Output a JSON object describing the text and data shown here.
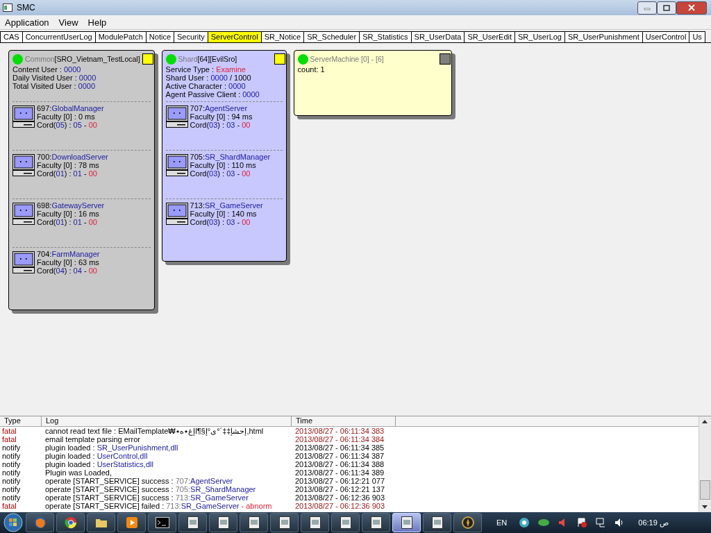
{
  "window": {
    "title": "SMC"
  },
  "menu": [
    "Application",
    "View",
    "Help"
  ],
  "tabs": [
    {
      "label": "CAS",
      "selected": false
    },
    {
      "label": "ConcurrentUserLog",
      "selected": false
    },
    {
      "label": "ModulePatch",
      "selected": false
    },
    {
      "label": "Notice",
      "selected": false
    },
    {
      "label": "Security",
      "selected": false
    },
    {
      "label": "ServerControl",
      "selected": true
    },
    {
      "label": "SR_Notice",
      "selected": false
    },
    {
      "label": "SR_Scheduler",
      "selected": false
    },
    {
      "label": "SR_Statistics",
      "selected": false
    },
    {
      "label": "SR_UserData",
      "selected": false
    },
    {
      "label": "SR_UserEdit",
      "selected": false
    },
    {
      "label": "SR_UserLog",
      "selected": false
    },
    {
      "label": "SR_UserPunishment",
      "selected": false
    },
    {
      "label": "UserControl",
      "selected": false
    },
    {
      "label": "Us",
      "selected": false
    }
  ],
  "cards": [
    {
      "kind": "common",
      "online": true,
      "color": "#ffff00",
      "group": "Common",
      "name": "[SRO_Vietnam_TestLocal]",
      "stats": [
        {
          "label": "Content User : ",
          "value": "0000"
        },
        {
          "label": "Daily Visited User : ",
          "value": "0000"
        },
        {
          "label": "Total Visited User : ",
          "value": "0000"
        }
      ],
      "servers": [
        {
          "id": "697:",
          "name": "GlobalManager",
          "faculty": "Faculty [0] : 0 ms",
          "cord": {
            "prefix": "Cord(",
            "count": "05",
            "mid": ") : ",
            "value": "05",
            "sep": " - ",
            "error": "00"
          }
        },
        {
          "id": "700:",
          "name": "DownloadServer",
          "faculty": "Faculty [0] : 78 ms",
          "cord": {
            "prefix": "Cord(",
            "count": "01",
            "mid": ") : ",
            "value": "01",
            "sep": " - ",
            "error": "00"
          }
        },
        {
          "id": "698:",
          "name": "GatewayServer",
          "faculty": "Faculty [0] : 16 ms",
          "cord": {
            "prefix": "Cord(",
            "count": "01",
            "mid": ") : ",
            "value": "01",
            "sep": " - ",
            "error": "00"
          }
        },
        {
          "id": "704:",
          "name": "FarmManager",
          "faculty": "Faculty [0] : 63 ms",
          "cord": {
            "prefix": "Cord(",
            "count": "04",
            "mid": ") : ",
            "value": "04",
            "sep": " - ",
            "error": "00"
          }
        }
      ]
    },
    {
      "kind": "shard",
      "online": true,
      "color": "#ffff00",
      "group": "Shard",
      "name": "[64][EvilSro]",
      "stats": [
        {
          "label": "Service Type : ",
          "alert": "Examine"
        },
        {
          "label": "Shard User : ",
          "value": "0000",
          "total": " / 1000"
        },
        {
          "label": "Active Character : ",
          "value": "0000"
        },
        {
          "label": "Agent Passive Client : ",
          "value": "0000"
        }
      ],
      "servers": [
        {
          "id": "707:",
          "name": "AgentServer",
          "faculty": "Faculty [0] : 94 ms",
          "cord": {
            "prefix": "Cord(",
            "count": "03",
            "mid": ") : ",
            "value": "03",
            "sep": " - ",
            "error": "00"
          }
        },
        {
          "id": "705:",
          "name": "SR_ShardManager",
          "faculty": "Faculty [0] : 110 ms",
          "cord": {
            "prefix": "Cord(",
            "count": "03",
            "mid": ") : ",
            "value": "03",
            "sep": " - ",
            "error": "00"
          }
        },
        {
          "id": "713:",
          "name": "SR_GameServer",
          "faculty": "Faculty [0] : 140 ms",
          "cord": {
            "prefix": "Cord(",
            "count": "03",
            "mid": ") : ",
            "value": "03",
            "sep": " - ",
            "error": "00"
          }
        }
      ]
    },
    {
      "kind": "machine",
      "online": true,
      "color": "#808080",
      "group": "ServerMachine [0] - [6]",
      "stats": [
        {
          "label": "count: 1"
        }
      ]
    }
  ],
  "log": {
    "columns": [
      "Type",
      "Log",
      "Time"
    ],
    "rows": [
      {
        "type": "fatal",
        "message": "cannot read text file : EMailTemplate₩إحشإ‡‡´°ى°إ§¶اإغ٭ﻩ٭,html",
        "time": "2013/08/27 - 06:11:34 383"
      },
      {
        "type": "fatal",
        "message": "email template parsing error",
        "time": "2013/08/27 - 06:11:34 384"
      },
      {
        "type": "notify",
        "message": "plugin loaded : ",
        "target": "SR_UserPunishment,dll",
        "time": "2013/08/27 - 06:11:34 385"
      },
      {
        "type": "notify",
        "message": "plugin loaded : ",
        "target": "UserControl,dll",
        "time": "2013/08/27 - 06:11:34 387"
      },
      {
        "type": "notify",
        "message": "plugin loaded : ",
        "target": "UserStatistics,dll",
        "time": "2013/08/27 - 06:11:34 388"
      },
      {
        "type": "notify",
        "message": "Plugin was Loaded,",
        "time": "2013/08/27 - 06:11:34 389"
      },
      {
        "type": "notify",
        "message": "operate [START_SERVICE] success : ",
        "server_id": "707:",
        "target": "AgentServer",
        "time": "2013/08/27 - 06:12:21 077"
      },
      {
        "type": "notify",
        "message": "operate [START_SERVICE] success : ",
        "server_id": "705:",
        "target": "SR_ShardManager",
        "time": "2013/08/27 - 06:12:21 137"
      },
      {
        "type": "notify",
        "message": "operate [START_SERVICE] success : ",
        "server_id": "713:",
        "target": "SR_GameServer",
        "time": "2013/08/27 - 06:12:36 903"
      },
      {
        "type": "fatal",
        "message": "operate [START_SERVICE] failed : ",
        "server_id": "713:",
        "target": "SR_GameServer",
        "error": " - abnorm",
        "time": "2013/08/27 - 06:12:36 903"
      }
    ]
  },
  "taskbar": {
    "apps": [
      {
        "kind": "firefox",
        "selected": false
      },
      {
        "kind": "chrome",
        "selected": false
      },
      {
        "kind": "folder",
        "selected": false
      },
      {
        "kind": "media",
        "selected": false
      },
      {
        "kind": "console",
        "selected": false
      },
      {
        "kind": "window",
        "selected": false
      },
      {
        "kind": "window",
        "selected": false
      },
      {
        "kind": "window",
        "selected": false
      },
      {
        "kind": "window",
        "selected": false
      },
      {
        "kind": "window",
        "selected": false
      },
      {
        "kind": "window",
        "selected": false
      },
      {
        "kind": "window",
        "selected": false
      },
      {
        "kind": "window",
        "selected": true
      },
      {
        "kind": "window",
        "selected": false
      },
      {
        "kind": "compass",
        "selected": false
      }
    ],
    "language": "EN",
    "clock": "06:19 ص"
  }
}
